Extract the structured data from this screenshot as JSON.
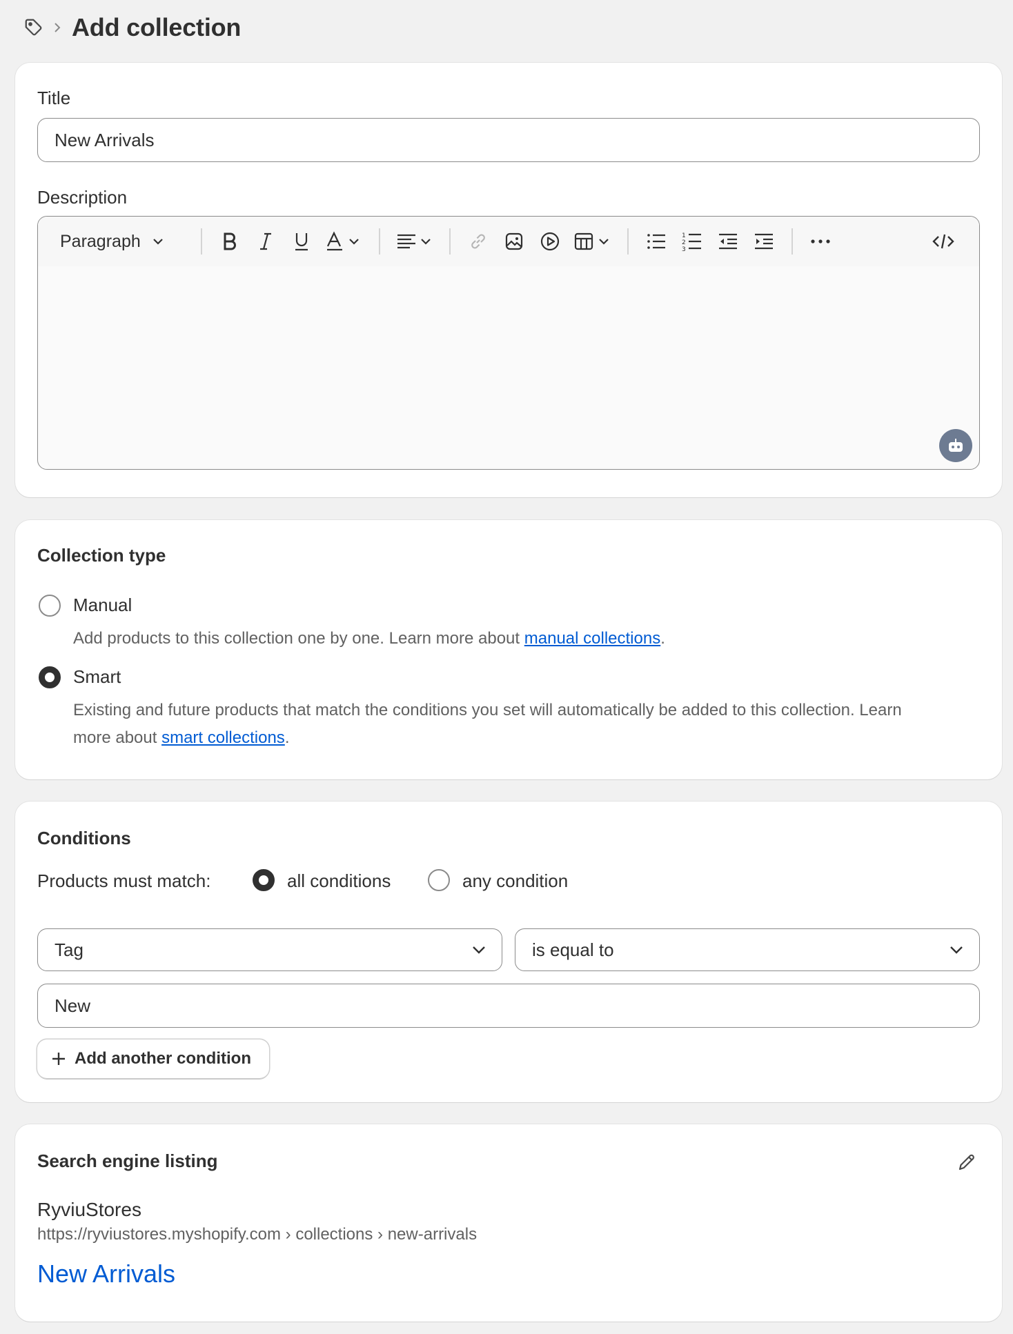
{
  "header": {
    "breadcrumb_icon": "tag-icon",
    "title": "Add collection"
  },
  "general": {
    "title_label": "Title",
    "title_value": "New Arrivals",
    "description_label": "Description",
    "toolbar": {
      "paragraph_label": "Paragraph",
      "icons": [
        "bold-icon",
        "italic-icon",
        "underline-icon",
        "text-color-icon",
        "align-icon",
        "link-icon",
        "image-icon",
        "video-icon",
        "table-icon",
        "bullet-list-icon",
        "numbered-list-icon",
        "outdent-icon",
        "indent-icon",
        "more-icon",
        "code-icon"
      ]
    },
    "description_value": ""
  },
  "collection_type": {
    "title": "Collection type",
    "manual_label": "Manual",
    "manual_help_prefix": "Add products to this collection one by one. Learn more about ",
    "manual_help_link": "manual collections",
    "manual_help_suffix": ".",
    "smart_label": "Smart",
    "smart_help_line1": "Existing and future products that match the conditions you set will automatically be added to this collection. Learn",
    "smart_help_prefix": "more about ",
    "smart_help_link": "smart collections",
    "smart_help_suffix": ".",
    "selected": "Smart"
  },
  "conditions": {
    "title": "Conditions",
    "match_label": "Products must match:",
    "all_label": "all conditions",
    "any_label": "any condition",
    "selected": "all conditions",
    "field_value": "Tag",
    "operator_value": "is equal to",
    "condition_value": "New",
    "add_button_label": "Add another condition"
  },
  "seo": {
    "title": "Search engine listing",
    "store_name": "RyviuStores",
    "url": "https://ryviustores.myshopify.com › collections › new-arrivals",
    "page_title": "New Arrivals"
  },
  "colors": {
    "background": "#f1f1f1",
    "card": "#ffffff",
    "text": "#303030",
    "subdued": "#616161",
    "link": "#005bd3",
    "ai_button": "#6d7b92"
  }
}
